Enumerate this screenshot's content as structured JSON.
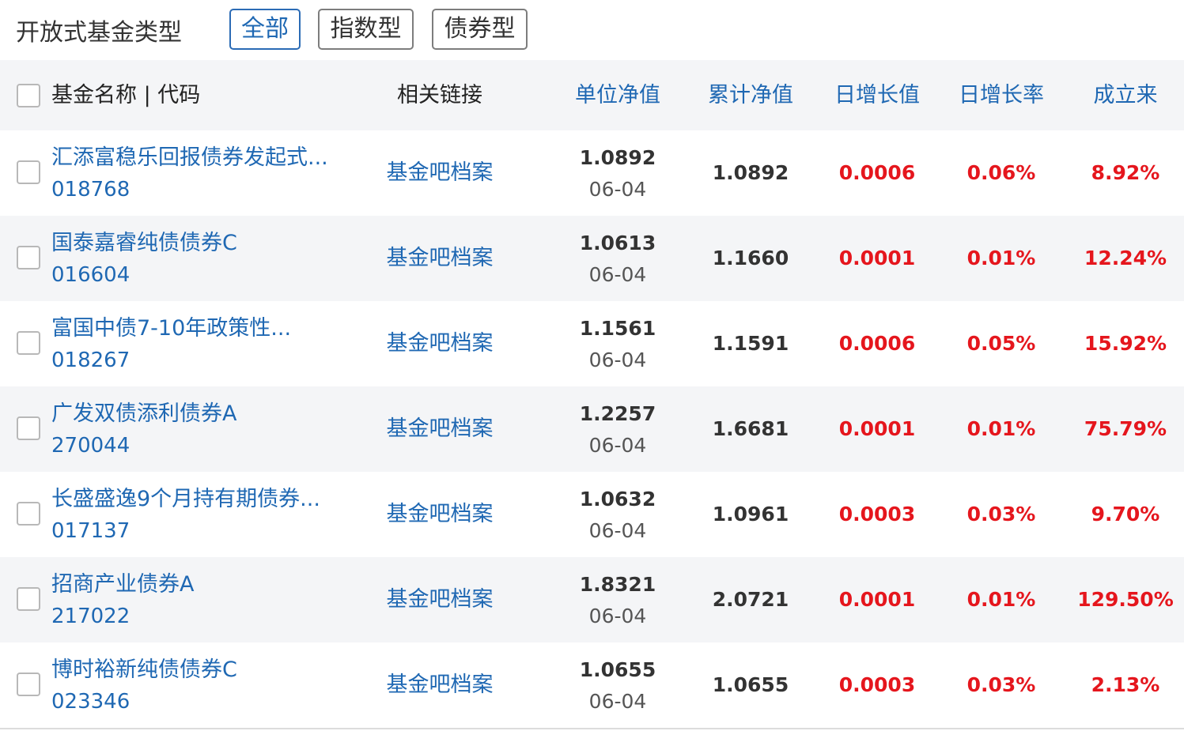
{
  "filter": {
    "label": "开放式基金类型",
    "buttons": [
      {
        "label": "全部",
        "active": true
      },
      {
        "label": "指数型",
        "active": false
      },
      {
        "label": "债券型",
        "active": false
      }
    ]
  },
  "table": {
    "headers": {
      "name": "基金名称 | 代码",
      "links": "相关链接",
      "unit_nav": "单位净值",
      "acc_nav": "累计净值",
      "daily_value": "日增长值",
      "daily_rate": "日增长率",
      "since": "成立来"
    },
    "link_labels": {
      "bar": "基金吧",
      "archive": "档案"
    },
    "rows": [
      {
        "name": "汇添富稳乐回报债券发起式...",
        "code": "018768",
        "unit_nav": "1.0892",
        "date": "06-04",
        "acc_nav": "1.0892",
        "daily_value": "0.0006",
        "daily_rate": "0.06%",
        "since": "8.92%"
      },
      {
        "name": "国泰嘉睿纯债债券C",
        "code": "016604",
        "unit_nav": "1.0613",
        "date": "06-04",
        "acc_nav": "1.1660",
        "daily_value": "0.0001",
        "daily_rate": "0.01%",
        "since": "12.24%"
      },
      {
        "name": "富国中债7-10年政策性...",
        "code": "018267",
        "unit_nav": "1.1561",
        "date": "06-04",
        "acc_nav": "1.1591",
        "daily_value": "0.0006",
        "daily_rate": "0.05%",
        "since": "15.92%"
      },
      {
        "name": "广发双债添利债券A",
        "code": "270044",
        "unit_nav": "1.2257",
        "date": "06-04",
        "acc_nav": "1.6681",
        "daily_value": "0.0001",
        "daily_rate": "0.01%",
        "since": "75.79%"
      },
      {
        "name": "长盛盛逸9个月持有期债券...",
        "code": "017137",
        "unit_nav": "1.0632",
        "date": "06-04",
        "acc_nav": "1.0961",
        "daily_value": "0.0003",
        "daily_rate": "0.03%",
        "since": "9.70%"
      },
      {
        "name": "招商产业债券A",
        "code": "217022",
        "unit_nav": "1.8321",
        "date": "06-04",
        "acc_nav": "2.0721",
        "daily_value": "0.0001",
        "daily_rate": "0.01%",
        "since": "129.50%"
      },
      {
        "name": "博时裕新纯债债券C",
        "code": "023346",
        "unit_nav": "1.0655",
        "date": "06-04",
        "acc_nav": "1.0655",
        "daily_value": "0.0003",
        "daily_rate": "0.03%",
        "since": "2.13%"
      }
    ]
  },
  "colors": {
    "link_blue": "#1f68b3",
    "positive_red": "#e5161d",
    "row_shade": "#f4f5f7"
  }
}
